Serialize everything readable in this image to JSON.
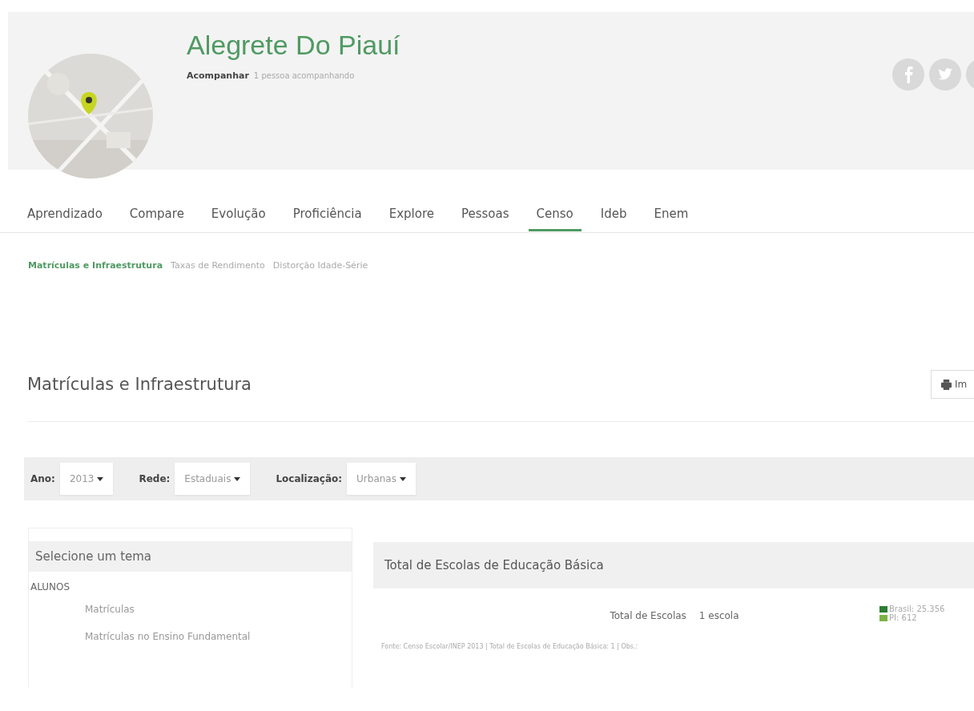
{
  "profile": {
    "title": "Alegrete Do Piauí",
    "follow_button": "Acompanhar",
    "followers": "1 pessoa acompanhando",
    "social": [
      {
        "kind": "facebook"
      },
      {
        "kind": "twitter"
      },
      {
        "kind": "other"
      }
    ]
  },
  "tabs": [
    {
      "label": "Aprendizado",
      "selected": false
    },
    {
      "label": "Compare",
      "selected": false
    },
    {
      "label": "Evolução",
      "selected": false
    },
    {
      "label": "Proficiência",
      "selected": false
    },
    {
      "label": "Explore",
      "selected": false
    },
    {
      "label": "Pessoas",
      "selected": false
    },
    {
      "label": "Censo",
      "selected": true
    },
    {
      "label": "Ideb",
      "selected": false
    },
    {
      "label": "Enem",
      "selected": false
    }
  ],
  "subtabs": [
    {
      "label": "Matrículas e Infraestrutura",
      "selected": true
    },
    {
      "label": "Taxas de Rendimento",
      "selected": false
    },
    {
      "label": "Distorção Idade-Série",
      "selected": false
    }
  ],
  "section": {
    "title": "Matrículas e Infraestrutura",
    "print_button": "Im"
  },
  "filters": [
    {
      "label": "Ano:",
      "value": "2013"
    },
    {
      "label": "Rede:",
      "value": "Estaduais"
    },
    {
      "label": "Localização:",
      "value": "Urbanas"
    }
  ],
  "sidebar": {
    "title": "Selecione um tema",
    "groups": [
      {
        "label": "ALUNOS",
        "items": [
          {
            "label": "Matrículas"
          },
          {
            "label": "Matrículas no Ensino Fundamental"
          }
        ]
      }
    ]
  },
  "panel": {
    "title": "Total de Escolas de Educação Básica",
    "metric_label": "Total de Escolas",
    "metric_value": "1 escola",
    "legend": [
      {
        "label": "Brasil: 25.356",
        "color": "#2e7d32"
      },
      {
        "label": "PI: 612",
        "color": "#7cb342"
      }
    ],
    "source": "Fonte: Censo Escolar/INEP 2013 | Total de Escolas de Educação Básica: 1 | Obs.:"
  }
}
